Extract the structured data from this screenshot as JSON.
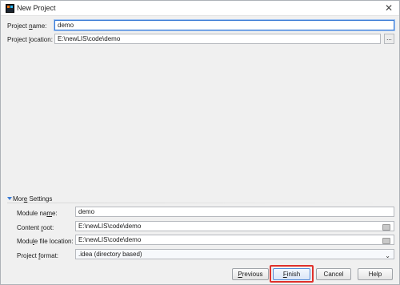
{
  "window": {
    "title": "New Project",
    "close_glyph": "✕"
  },
  "form": {
    "project_name": {
      "label_pre": "Project ",
      "label_u": "n",
      "label_post": "ame:",
      "value": "demo"
    },
    "project_location": {
      "label_pre": "Project ",
      "label_u": "l",
      "label_post": "ocation:",
      "value": "E:\\newLIS\\code\\demo",
      "browse": "..."
    }
  },
  "more_settings": {
    "label_pre": "Mor",
    "label_u": "e",
    "label_post": " Settings",
    "module_name": {
      "label_pre": "Module na",
      "label_u": "m",
      "label_post": "e:",
      "value": "demo"
    },
    "content_root": {
      "label_pre": "Content ",
      "label_u": "r",
      "label_post": "oot:",
      "value": "E:\\newLIS\\code\\demo"
    },
    "module_file_location": {
      "label_pre": "Modu",
      "label_u": "l",
      "label_post": "e file location:",
      "value": "E:\\newLIS\\code\\demo"
    },
    "project_format": {
      "label_pre": "Project ",
      "label_u": "f",
      "label_post": "ormat:",
      "value": ".idea (directory based)"
    }
  },
  "buttons": {
    "previous": {
      "pre": "",
      "u": "P",
      "post": "revious"
    },
    "finish": {
      "pre": "",
      "u": "F",
      "post": "inish"
    },
    "cancel": "Cancel",
    "help": "Help"
  },
  "colors": {
    "highlight": "#e0312b",
    "focus": "#3a7bd5"
  },
  "icons": {
    "app": "intellij-idea-icon",
    "close": "close-icon",
    "folder": "folder-icon",
    "collapse": "collapse-arrow-icon",
    "dropdown": "chevron-down-icon"
  }
}
